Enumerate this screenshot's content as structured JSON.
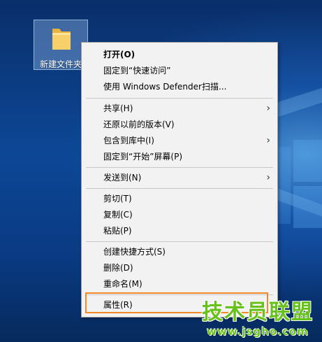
{
  "desktop": {
    "icon_label": "新建文件夹"
  },
  "menu": {
    "items": [
      {
        "label": "打开(O)",
        "bold": true
      },
      {
        "label": "固定到“快速访问”"
      },
      {
        "label": "使用 Windows Defender扫描..."
      },
      {
        "label": "共享(H)",
        "submenu": true
      },
      {
        "label": "还原以前的版本(V)"
      },
      {
        "label": "包含到库中(I)",
        "submenu": true
      },
      {
        "label": "固定到“开始”屏幕(P)"
      },
      {
        "label": "发送到(N)",
        "submenu": true
      },
      {
        "label": "剪切(T)"
      },
      {
        "label": "复制(C)"
      },
      {
        "label": "粘贴(P)"
      },
      {
        "label": "创建快捷方式(S)"
      },
      {
        "label": "删除(D)"
      },
      {
        "label": "重命名(M)"
      },
      {
        "label": "属性(R)",
        "highlighted": true
      }
    ],
    "submenu_arrow": "›"
  },
  "watermark": {
    "title": "技术员联盟",
    "url": "www.jsgho.com"
  },
  "colors": {
    "highlight_border": "#f08a24",
    "watermark_green": "#66c21a"
  }
}
